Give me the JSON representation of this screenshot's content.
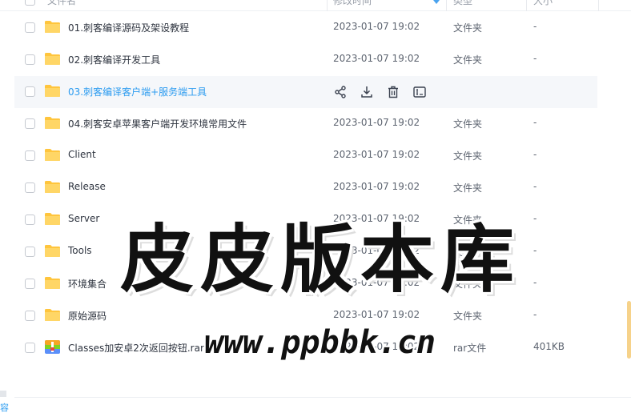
{
  "columns": {
    "name": "文件名",
    "modified": "修改时间",
    "type": "类型",
    "size": "大小"
  },
  "rows": [
    {
      "name": "01.刺客编译源码及架设教程",
      "date": "2023-01-07 19:02",
      "type": "文件夹",
      "size": "-",
      "icon": "folder-icon"
    },
    {
      "name": "02.刺客编译开发工具",
      "date": "2023-01-07 19:02",
      "type": "文件夹",
      "size": "-",
      "icon": "folder-icon"
    },
    {
      "name": "03.刺客编译客户端+服务端工具",
      "date": "",
      "type": "",
      "size": "",
      "icon": "folder-icon",
      "hover": true
    },
    {
      "name": "04.刺客安卓苹果客户端开发环境常用文件",
      "date": "2023-01-07 19:02",
      "type": "文件夹",
      "size": "-",
      "icon": "folder-icon"
    },
    {
      "name": "Client",
      "date": "2023-01-07 19:02",
      "type": "文件夹",
      "size": "-",
      "icon": "folder-icon"
    },
    {
      "name": "Release",
      "date": "2023-01-07 19:02",
      "type": "文件夹",
      "size": "-",
      "icon": "folder-icon"
    },
    {
      "name": "Server",
      "date": "2023-01-07 19:02",
      "type": "文件夹",
      "size": "-",
      "icon": "folder-icon"
    },
    {
      "name": "Tools",
      "date": "2023-01-07 19:02",
      "type": "文件夹",
      "size": "-",
      "icon": "folder-icon"
    },
    {
      "name": "环境集合",
      "date": "2023-01-07 19:02",
      "type": "文件夹",
      "size": "-",
      "icon": "folder-icon"
    },
    {
      "name": "原始源码",
      "date": "2023-01-07 19:02",
      "type": "文件夹",
      "size": "-",
      "icon": "folder-icon"
    },
    {
      "name": "Classes加安卓2次返回按钮.rar",
      "date": "2023-01-07 19:02",
      "type": "rar文件",
      "size": "401KB",
      "icon": "rar-archive-icon"
    }
  ],
  "hover_actions": [
    "share-icon",
    "download-icon",
    "delete-icon",
    "rename-icon"
  ],
  "bottom_left_text": "容",
  "watermark": {
    "line1": "皮皮版本库",
    "line2": "www.ppbbk.cn"
  },
  "colors": {
    "accent": "#2d9cf0",
    "folder": "#ffc53d",
    "hover_row": "#f5f7fa"
  }
}
